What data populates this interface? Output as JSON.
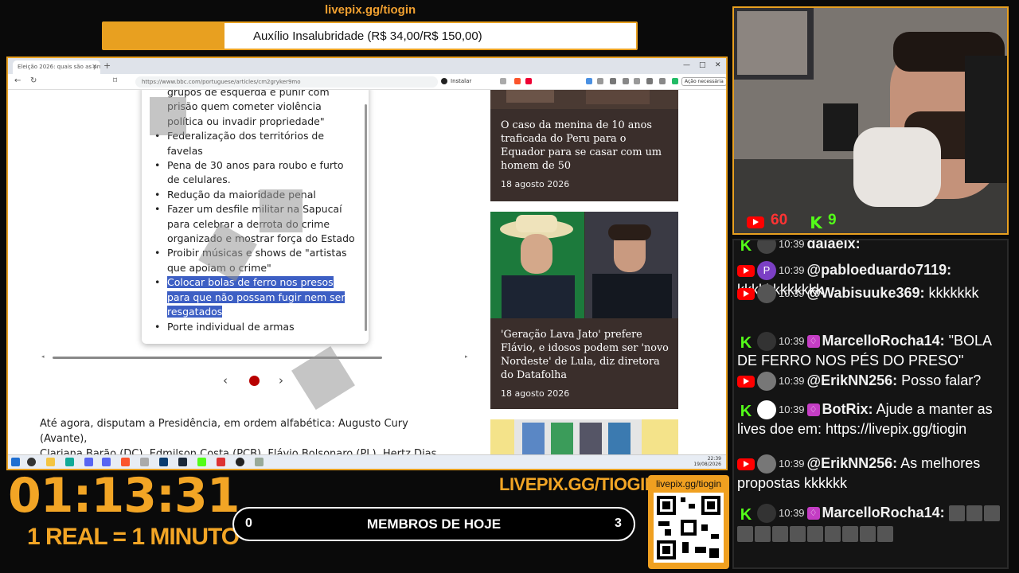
{
  "goal": {
    "url": "livepix.gg/tiogin",
    "label": "Auxílio Insalubridade (R$ 34,00/R$ 150,00)",
    "current": 34,
    "target": 150,
    "fill_color": "#e8a020"
  },
  "browser": {
    "tab_title": "Eleição 2026: quais são as propo...",
    "url": "https://www.bbc.com/portuguese/articles/cm2gryker9mo",
    "install_label": "Instalar",
    "action_label": "Ação necessária"
  },
  "article": {
    "bullets": [
      {
        "lines": [
          "grupos de esquerda e punir com",
          "prisão quem cometer violência",
          "política ou invadir propriedade\""
        ],
        "first_bullet": false
      },
      {
        "lines": [
          "Federalização dos territórios de",
          "favelas"
        ],
        "first_bullet": true
      },
      {
        "lines": [
          "Pena de 30 anos para roubo e furto",
          "de celulares."
        ],
        "first_bullet": true
      },
      {
        "lines": [
          "Redução da maioridade penal"
        ],
        "first_bullet": true
      },
      {
        "lines": [
          "Fazer um desfile militar na Sapucaí",
          "para celebrar a derrota do crime",
          "organizado e mostrar força do Estado"
        ],
        "first_bullet": true
      },
      {
        "lines": [
          "Proibir músicas e shows de \"artistas",
          "que apoiam o crime\""
        ],
        "first_bullet": true
      },
      {
        "lines": [
          "Colocar bolas de ferro nos presos",
          "para que não possam fugir nem ser",
          "resgatados"
        ],
        "first_bullet": true,
        "highlighted": true
      },
      {
        "lines": [
          "Porte individual de armas"
        ],
        "first_bullet": true
      }
    ],
    "pager_prev": "‹",
    "pager_next": "›",
    "body_lines": [
      "Até agora, disputam a Presidência, em ordem alfabética: Augusto Cury (Avante),",
      "Clariana Barão (DC), Edmilson Costa (PCB), Flávio Bolsonaro (PL), Hertz Dias"
    ]
  },
  "cards": [
    {
      "title_lines": [
        "O caso da menina de 10 anos",
        "traficada do Peru para o",
        "Equador para se casar com um",
        "homem de 50"
      ],
      "date": "18 agosto 2026"
    },
    {
      "title_lines": [
        "'Geração Lava Jato' prefere",
        "Flávio, e idosos podem ser 'novo",
        "Nordeste' de Lula, diz diretora",
        "do Datafolha"
      ],
      "date": "18 agosto 2026"
    }
  ],
  "taskbar": {
    "time": "22:39",
    "date": "19/08/2026"
  },
  "cam": {
    "yt_count": "60",
    "kick_count": "9"
  },
  "chat": {
    "messages": [
      {
        "platform": "kick",
        "time": "10:39",
        "user": "dalaeix:",
        "text": ""
      },
      {
        "platform": "youtube",
        "avatar": "P",
        "avatar_color": "#7b3fc4",
        "time": "10:39",
        "user": "@pabloeduardo7119:",
        "text": "kkkkkkkkkkkk"
      },
      {
        "platform": "youtube",
        "avatar": "",
        "avatar_color": "#555",
        "time": "10:39",
        "user": "@Wabisuuke369:",
        "text": "kkkkkkk"
      },
      {
        "platform": "kick",
        "avatar": "",
        "avatar_color": "#333",
        "time": "10:39",
        "user": "MarcelloRocha14:",
        "text": "\"BOLA DE FERRO NOS PÉS DO PRESO\""
      },
      {
        "platform": "youtube",
        "avatar": "",
        "avatar_color": "#777",
        "time": "10:39",
        "user": "@ErikNN256:",
        "text": "Posso falar?"
      },
      {
        "platform": "kick",
        "avatar": "",
        "avatar_color": "#fff",
        "time": "10:39",
        "user": "BotRix:",
        "text": "Ajude a manter as lives doe em: https://livepix.gg/tiogin"
      },
      {
        "platform": "youtube",
        "avatar": "",
        "avatar_color": "#777",
        "time": "10:39",
        "user": "@ErikNN256:",
        "text": "As melhores propostas kkkkkk"
      },
      {
        "platform": "kick",
        "avatar": "",
        "avatar_color": "#333",
        "time": "10:39",
        "user": "MarcelloRocha14:",
        "text": ""
      }
    ]
  },
  "timer": "01:13:31",
  "rate": "1 REAL = 1 MINUTO",
  "livepix_big": "LIVEPIX.GG/TIOGIN",
  "members": {
    "label": "MEMBROS DE HOJE",
    "left": "0",
    "right": "3"
  },
  "qr": {
    "label": "livepix.gg/tiogin"
  },
  "colors": {
    "accent": "#f2a525",
    "bbc_red": "#b80000",
    "highlight": "#3d5fc4"
  }
}
